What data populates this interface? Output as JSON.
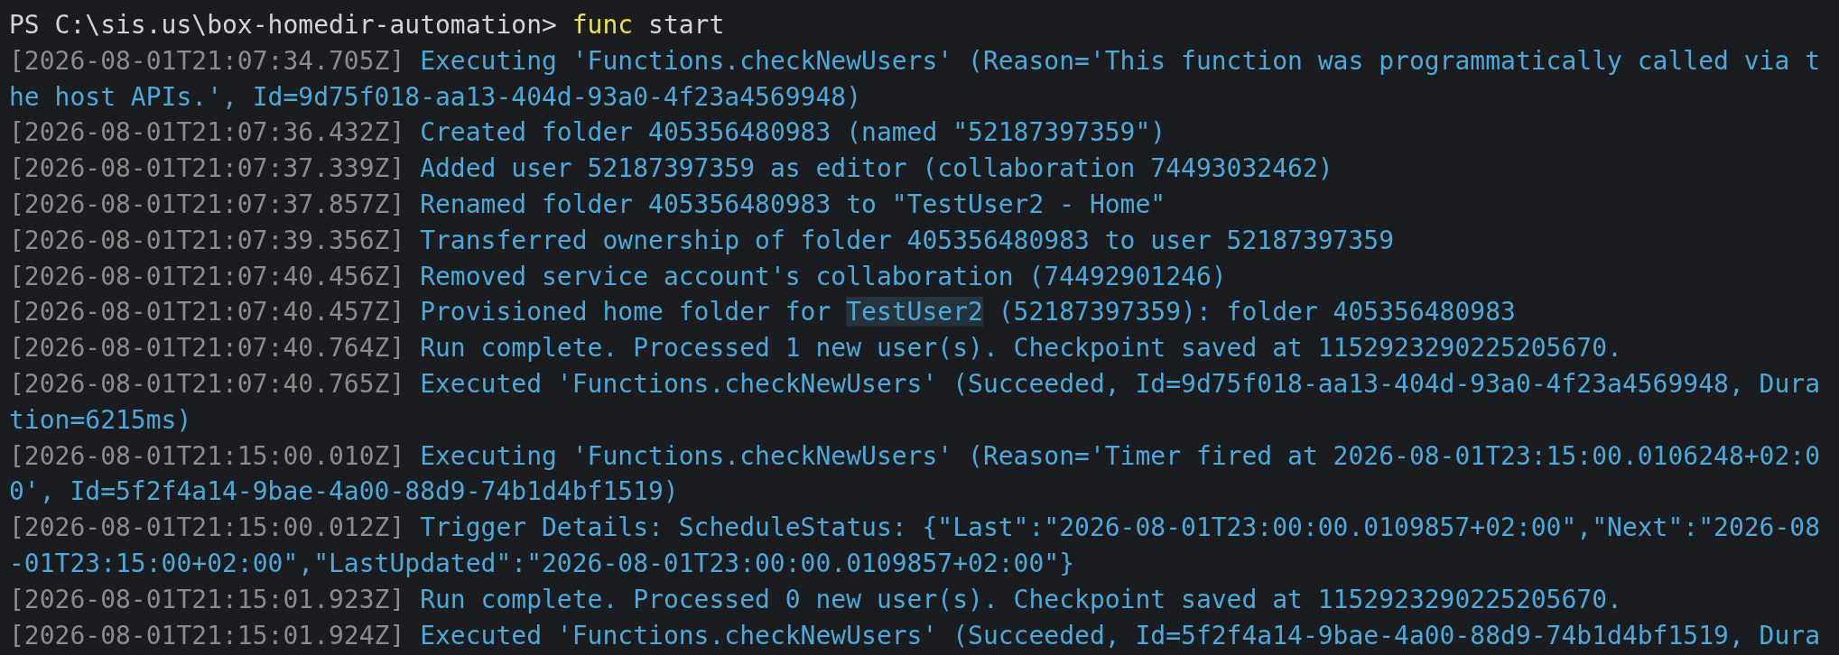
{
  "prompt": {
    "path": "PS C:\\sis.us\\box-homedir-automation>",
    "command": "func",
    "args": "start"
  },
  "log": [
    {
      "timestamp": "[2026-08-01T21:07:34.705Z]",
      "parts": [
        {
          "text": "Executing 'Functions.checkNewUsers' (Reason='This function was programmatically called via the host APIs.', Id=9d75f018-aa13-404d-93a0-4f23a4569948)",
          "highlighted": false
        }
      ]
    },
    {
      "timestamp": "[2026-08-01T21:07:36.432Z]",
      "parts": [
        {
          "text": "Created folder 405356480983 (named \"52187397359\")",
          "highlighted": false
        }
      ]
    },
    {
      "timestamp": "[2026-08-01T21:07:37.339Z]",
      "parts": [
        {
          "text": "Added user 52187397359 as editor (collaboration 74493032462)",
          "highlighted": false
        }
      ]
    },
    {
      "timestamp": "[2026-08-01T21:07:37.857Z]",
      "parts": [
        {
          "text": "Renamed folder 405356480983 to \"TestUser2 - Home\"",
          "highlighted": false
        }
      ]
    },
    {
      "timestamp": "[2026-08-01T21:07:39.356Z]",
      "parts": [
        {
          "text": "Transferred ownership of folder 405356480983 to user 52187397359",
          "highlighted": false
        }
      ]
    },
    {
      "timestamp": "[2026-08-01T21:07:40.456Z]",
      "parts": [
        {
          "text": "Removed service account's collaboration (74492901246)",
          "highlighted": false
        }
      ]
    },
    {
      "timestamp": "[2026-08-01T21:07:40.457Z]",
      "parts": [
        {
          "text": "Provisioned home folder for ",
          "highlighted": false
        },
        {
          "text": "TestUser2",
          "highlighted": true
        },
        {
          "text": " (52187397359): folder 405356480983",
          "highlighted": false
        }
      ]
    },
    {
      "timestamp": "[2026-08-01T21:07:40.764Z]",
      "parts": [
        {
          "text": "Run complete. Processed 1 new user(s). Checkpoint saved at 1152923290225205670.",
          "highlighted": false
        }
      ]
    },
    {
      "timestamp": "[2026-08-01T21:07:40.765Z]",
      "parts": [
        {
          "text": "Executed 'Functions.checkNewUsers' (Succeeded, Id=9d75f018-aa13-404d-93a0-4f23a4569948, Duration=6215ms)",
          "highlighted": false
        }
      ]
    },
    {
      "timestamp": "[2026-08-01T21:15:00.010Z]",
      "parts": [
        {
          "text": "Executing 'Functions.checkNewUsers' (Reason='Timer fired at 2026-08-01T23:15:00.0106248+02:00', Id=5f2f4a14-9bae-4a00-88d9-74b1d4bf1519)",
          "highlighted": false
        }
      ]
    },
    {
      "timestamp": "[2026-08-01T21:15:00.012Z]",
      "parts": [
        {
          "text": "Trigger Details: ScheduleStatus: {\"Last\":\"2026-08-01T23:00:00.0109857+02:00\",\"Next\":\"2026-08-01T23:15:00+02:00\",\"LastUpdated\":\"2026-08-01T23:00:00.0109857+02:00\"}",
          "highlighted": false
        }
      ]
    },
    {
      "timestamp": "[2026-08-01T21:15:01.923Z]",
      "parts": [
        {
          "text": "Run complete. Processed 0 new user(s). Checkpoint saved at 1152923290225205670.",
          "highlighted": false
        }
      ]
    },
    {
      "timestamp": "[2026-08-01T21:15:01.924Z]",
      "parts": [
        {
          "text": "Executed 'Functions.checkNewUsers' (Succeeded, Id=5f2f4a14-9bae-4a00-88d9-74b1d4bf1519, Dura",
          "highlighted": false
        }
      ]
    }
  ]
}
